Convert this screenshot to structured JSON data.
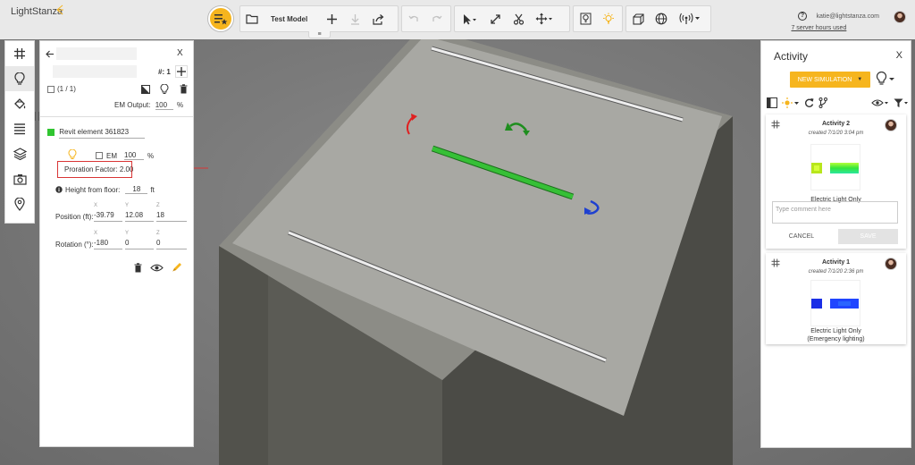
{
  "app": {
    "name": "LightStanza"
  },
  "header": {
    "model_name": "Test Model",
    "user_email": "katie@lightstanza.com",
    "server_hours": "7 server hours used"
  },
  "properties": {
    "selection_count": "(1 / 1)",
    "instance_label": "#: 1",
    "em_output_label": "EM Output:",
    "em_output_value": "100",
    "em_output_unit": "%",
    "element_name": "Revit element 361823",
    "em_label": "EM",
    "em_value": "100",
    "em_unit": "%",
    "proration_label": "Proration Factor:",
    "proration_value": "2.00",
    "height_label": "Height from floor:",
    "height_value": "18",
    "height_unit": "ft",
    "axis_x": "X",
    "axis_y": "Y",
    "axis_z": "Z",
    "position_label": "Position (ft):",
    "position_x": "-39.79",
    "position_y": "12.08",
    "position_z": "18",
    "rotation_label": "Rotation (°):",
    "rotation_x": "-180",
    "rotation_y": "0",
    "rotation_z": "0"
  },
  "activity": {
    "title": "Activity",
    "close": "X",
    "new_simulation": "NEW SIMULATION",
    "cards": [
      {
        "title": "Activity 2",
        "created": "created 7/1/20 3:04 pm",
        "caption": "Electric Light Only",
        "comment_placeholder": "Type comment here",
        "cancel": "CANCEL",
        "save": "SAVE"
      },
      {
        "title": "Activity 1",
        "created": "created 7/1/20 2:36 pm",
        "caption_line1": "Electric Light Only",
        "caption_line2": "(Emergency lighting)"
      }
    ]
  },
  "colors": {
    "accent": "#f6b51e",
    "element_swatch": "#30c530",
    "highlight": "#d83535",
    "rot_red": "#e02020",
    "rot_green": "#1e8e1e",
    "rot_blue": "#1e40d0"
  }
}
